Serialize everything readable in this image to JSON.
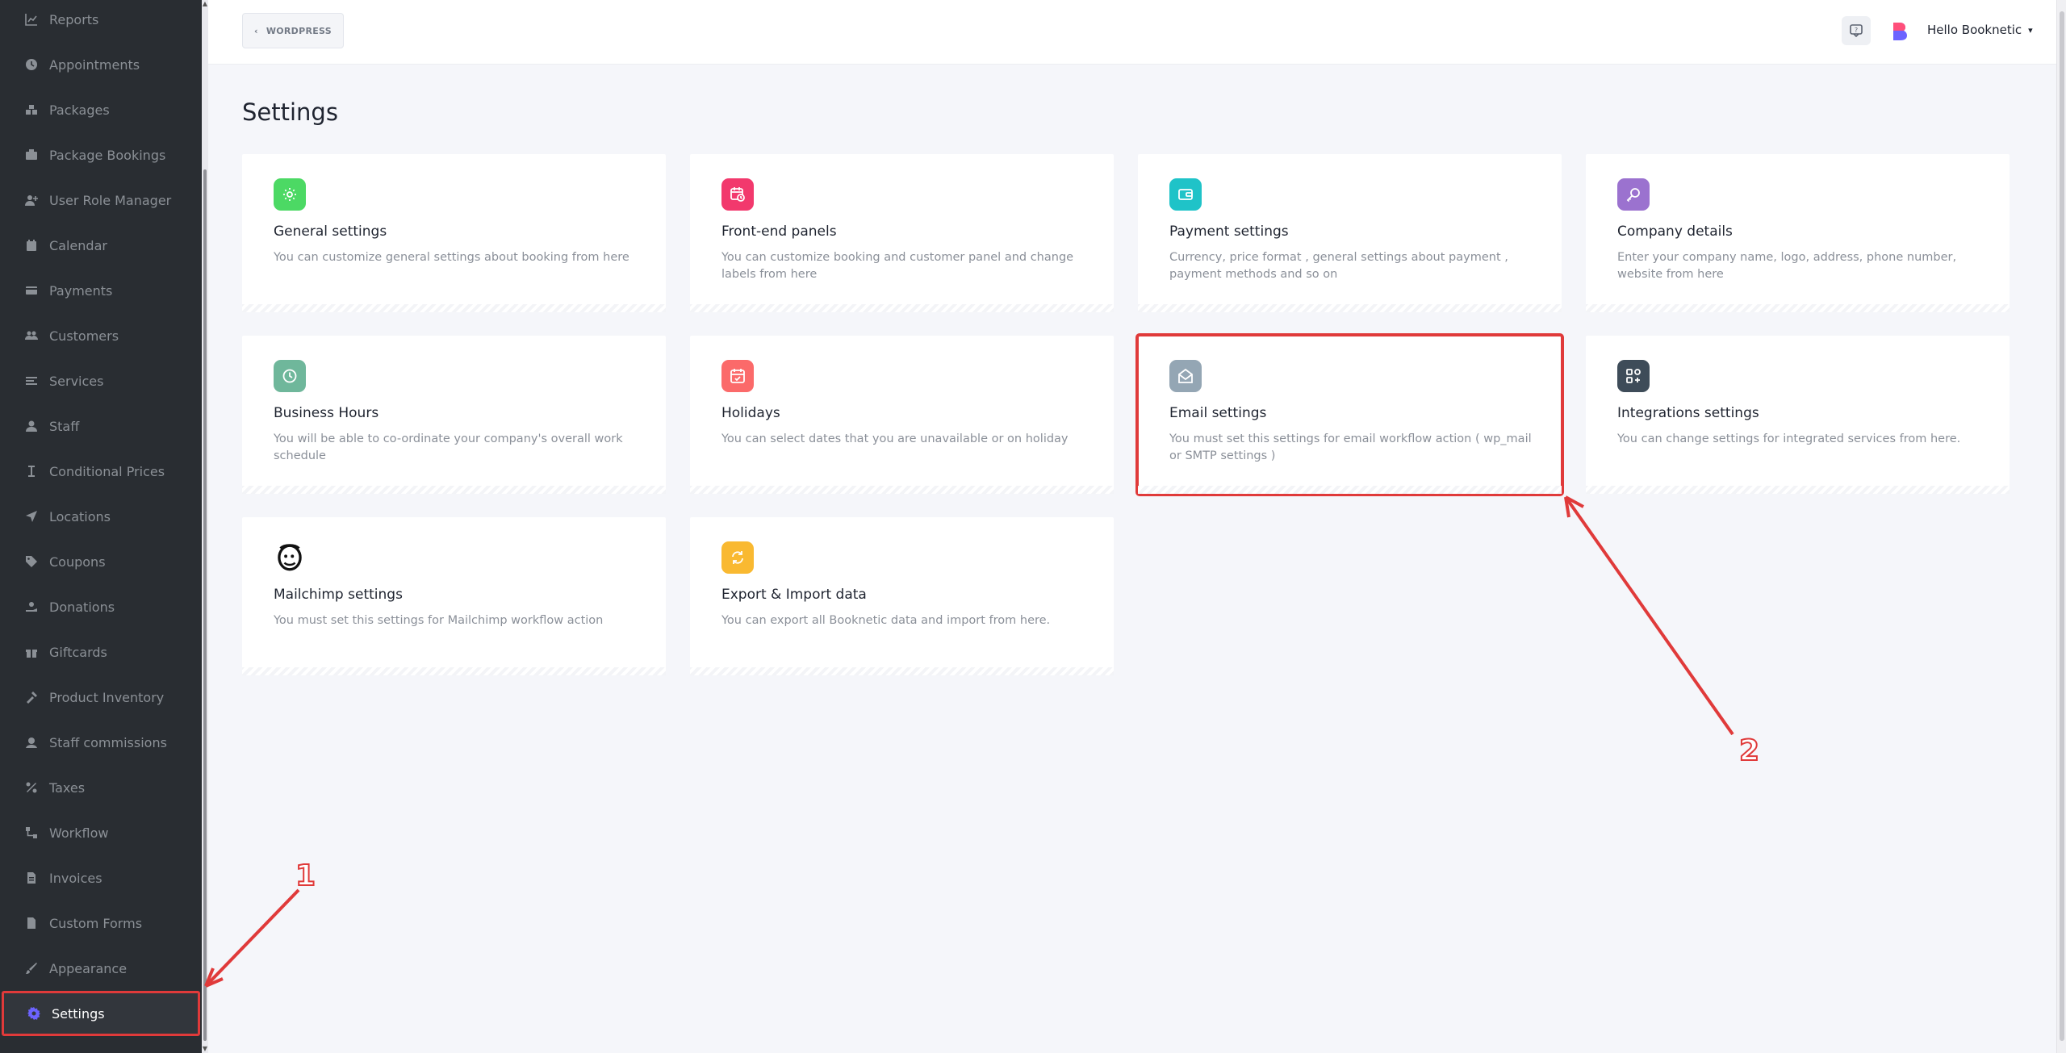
{
  "sidebar": {
    "items": [
      {
        "label": "Reports",
        "icon": "chart-icon"
      },
      {
        "label": "Appointments",
        "icon": "clock-icon"
      },
      {
        "label": "Packages",
        "icon": "packages-icon"
      },
      {
        "label": "Package Bookings",
        "icon": "package-bookings-icon"
      },
      {
        "label": "User Role Manager",
        "icon": "user-plus-icon"
      },
      {
        "label": "Calendar",
        "icon": "calendar-icon"
      },
      {
        "label": "Payments",
        "icon": "payments-icon"
      },
      {
        "label": "Customers",
        "icon": "users-icon"
      },
      {
        "label": "Services",
        "icon": "list-icon"
      },
      {
        "label": "Staff",
        "icon": "user-icon"
      },
      {
        "label": "Conditional Prices",
        "icon": "conditional-icon"
      },
      {
        "label": "Locations",
        "icon": "location-arrow-icon"
      },
      {
        "label": "Coupons",
        "icon": "tag-icon"
      },
      {
        "label": "Donations",
        "icon": "donation-icon"
      },
      {
        "label": "Giftcards",
        "icon": "gift-icon"
      },
      {
        "label": "Product Inventory",
        "icon": "tools-icon"
      },
      {
        "label": "Staff commissions",
        "icon": "commission-icon"
      },
      {
        "label": "Taxes",
        "icon": "percent-icon"
      },
      {
        "label": "Workflow",
        "icon": "workflow-icon"
      },
      {
        "label": "Invoices",
        "icon": "invoice-icon"
      },
      {
        "label": "Custom Forms",
        "icon": "forms-icon"
      },
      {
        "label": "Appearance",
        "icon": "brush-icon"
      },
      {
        "label": "Settings",
        "icon": "gear-icon",
        "active": true
      }
    ]
  },
  "header": {
    "back_label": "WORDPRESS",
    "greeting": "Hello Booknetic"
  },
  "page": {
    "title": "Settings"
  },
  "cards": [
    {
      "title": "General settings",
      "desc": "You can customize general settings about booking from here",
      "icon": "gear-icon",
      "color": "#4cd964"
    },
    {
      "title": "Front-end panels",
      "desc": "You can customize booking and customer panel and change labels from here",
      "icon": "calendar-clock-icon",
      "color": "#f2396d"
    },
    {
      "title": "Payment settings",
      "desc": "Currency, price format , general settings about payment , payment methods and so on",
      "icon": "wallet-icon",
      "color": "#1fc3c8"
    },
    {
      "title": "Company details",
      "desc": "Enter your company name, logo, address, phone number, website from here",
      "icon": "key-icon",
      "color": "#9b72cf"
    },
    {
      "title": "Business Hours",
      "desc": "You will be able to co-ordinate your company's overall work schedule",
      "icon": "clock-icon",
      "color": "#6fb79b"
    },
    {
      "title": "Holidays",
      "desc": "You can select dates that you are unavailable or on holiday",
      "icon": "calendar-check-icon",
      "color": "#fb6a6a"
    },
    {
      "title": "Email settings",
      "desc": "You must set this settings for email workflow action ( wp_mail or SMTP settings )",
      "icon": "envelope-open-icon",
      "color": "#94a6b4"
    },
    {
      "title": "Integrations settings",
      "desc": "You can change settings for integrated services from here.",
      "icon": "integrations-icon",
      "color": "#3e4c59"
    },
    {
      "title": "Mailchimp settings",
      "desc": "You must set this settings for Mailchimp workflow action",
      "icon": "mailchimp-icon",
      "color": "#ffffff"
    },
    {
      "title": "Export & Import data",
      "desc": "You can export all Booknetic data and import from here.",
      "icon": "sync-icon",
      "color": "#f9b931"
    }
  ],
  "annotations": {
    "label_1": "1",
    "label_2": "2",
    "color": "#e03a3a"
  }
}
